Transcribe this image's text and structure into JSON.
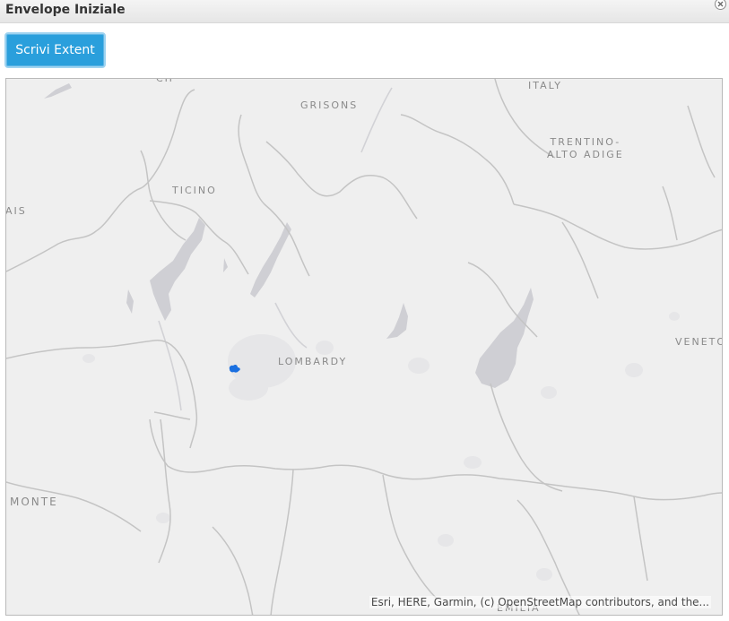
{
  "window": {
    "title": "Envelope Iniziale",
    "close_icon": "close-icon"
  },
  "toolbar": {
    "write_extent_label": "Scrivi Extent"
  },
  "map": {
    "labels": {
      "italy": "ITALY",
      "grisons": "GRISONS",
      "trentino_line1": "TRENTINO-",
      "trentino_line2": "ALTO ADIGE",
      "ticino": "TICINO",
      "valais_fragment": "AIS",
      "lombardy": "LOMBARDY",
      "veneto": "VENETO",
      "piemonte_fragment": "MONTE",
      "emilia_fragment": "EMILIA",
      "ch_fragment": "CH"
    },
    "attribution": "Esri, HERE, Garmin, (c) OpenStreetMap contributors, and the...",
    "colors": {
      "land": "#efefef",
      "water": "#cfcfd4",
      "borders": "#c4c4c4",
      "marker": "#1a6fe0",
      "button": "#2a9fdc"
    }
  }
}
